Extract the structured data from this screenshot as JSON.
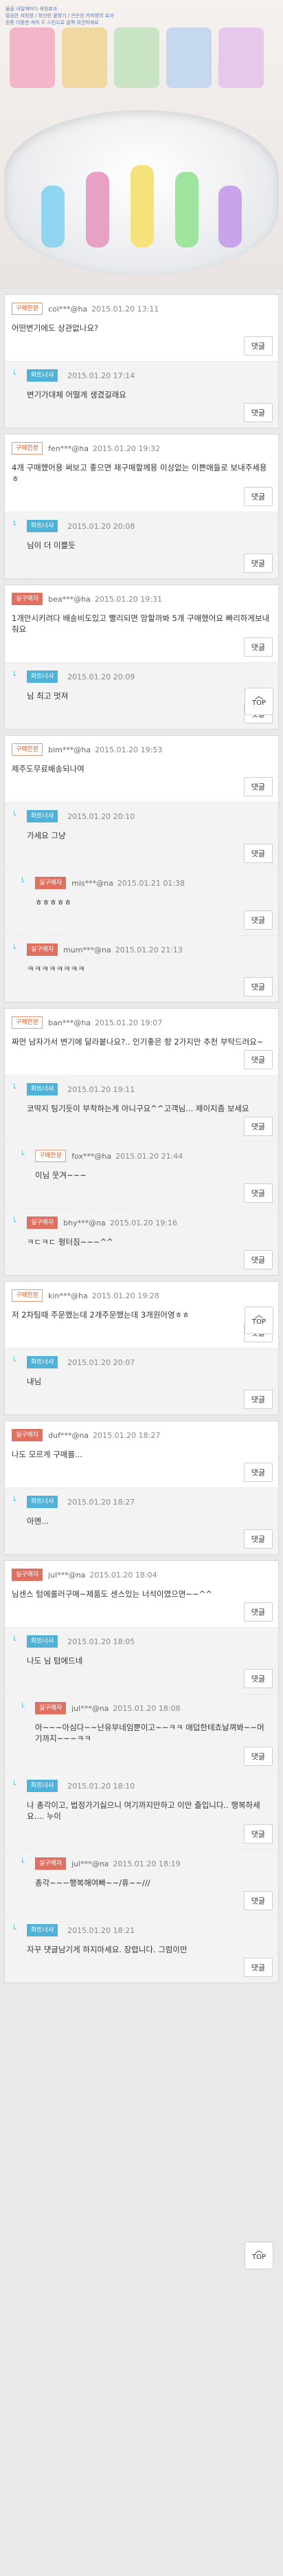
{
  "banner": {
    "bullets": [
      "물을 내릴때마다 세정효과",
      "말끔한 세정향 / 청산한 물향기 / 은은한 카피향의 효과",
      "원통 이중한 캐릭 두 스틴으로 컬팩 외관하세요"
    ]
  },
  "reply_label": "댓글",
  "top_label": "TOP",
  "tags": {
    "buyer": "구매한분",
    "seller": "화트너샤",
    "real": "실구매자"
  },
  "threads": [
    {
      "posts": [
        {
          "tag": "구매한분",
          "id": "col***@ha",
          "date": "2015.01.20 13:11",
          "text": "어떤변기에도 상관없나요?"
        },
        {
          "tag": "화트너샤",
          "id": "",
          "date": "2015.01.20 17:14",
          "text": "변기가대체 어떨게 생겼길래요"
        }
      ]
    },
    {
      "posts": [
        {
          "tag": "구매한분",
          "id": "fen***@ha",
          "date": "2015.01.20 19:32",
          "text": "4개 구매했어용 써보고 좋으면 재구매할께용 이상없는 이쁜애들로 보내주세용 ㅎ"
        },
        {
          "tag": "화트너샤",
          "id": "",
          "date": "2015.01.20 20:08",
          "text": "님이 더 이쁠듯"
        }
      ]
    },
    {
      "posts": [
        {
          "tag": "실구매자",
          "id": "bea***@ha",
          "date": "2015.01.20 19:31",
          "text": "1개만시키려다 배송비도있고 빨리되면 망할까봐 5개 구매했어요 빠리하게보내줘요"
        },
        {
          "tag": "화트너샤",
          "id": "",
          "date": "2015.01.20 20:09",
          "text": "님 최고 멋져"
        }
      ]
    },
    {
      "posts": [
        {
          "tag": "구매한분",
          "id": "bim***@ha",
          "date": "2015.01.20 19:53",
          "text": "제주도무료배송되나여"
        },
        {
          "tag": "화트너샤",
          "id": "",
          "date": "2015.01.20 20:10",
          "text": "가세요 그냥"
        },
        {
          "tag": "실구매자",
          "id": "mis***@na",
          "date": "2015.01.21 01:38",
          "text": "ㅎㅎㅎㅎㅎ"
        },
        {
          "tag": "실구매자",
          "id": "mum***@na",
          "date": "2015.01.20 21:13",
          "text": "ㅋㅋㅋㅋㅋㅋㅋㅋ"
        }
      ]
    },
    {
      "posts": [
        {
          "tag": "구매한분",
          "id": "ban***@ha",
          "date": "2015.01.20 19:07",
          "text": "짜먼 남자가서 변기에 달라붙나요?.. 인기좋은 향 2가지만 추천 부탁드려요~"
        },
        {
          "tag": "화트너샤",
          "id": "",
          "date": "2015.01.20 19:11",
          "text": "코딱지 팅기듯이 부착하는게 아니구요^^고객님... 제이지좀 보세요"
        },
        {
          "tag": "구매한분",
          "id": "fox***@ha",
          "date": "2015.01.20 21:44",
          "text": "이님 웃겨~~~"
        },
        {
          "tag": "실구매자",
          "id": "bhy***@na",
          "date": "2015.01.20 19:16",
          "text": "ㅋㄷㅋㄷ 펑터짐~~~^^"
        }
      ]
    },
    {
      "posts": [
        {
          "tag": "구매한분",
          "id": "kin***@ha",
          "date": "2015.01.20 19:28",
          "text": "저 2차팀때 주문했는데 2개주문했는데 3개원어영ㅎㅎ"
        },
        {
          "tag": "화트너샤",
          "id": "",
          "date": "2015.01.20 20:07",
          "text": "내님"
        }
      ]
    },
    {
      "posts": [
        {
          "tag": "실구매자",
          "id": "duf***@na",
          "date": "2015.01.20 18:27",
          "text": "나도 모르게 구매를..."
        },
        {
          "tag": "화트너샤",
          "id": "",
          "date": "2015.01.20 18:27",
          "text": "아멘..."
        }
      ]
    },
    {
      "posts": [
        {
          "tag": "실구매자",
          "id": "jul***@na",
          "date": "2015.01.20 18:04",
          "text": "님센스 텀에롤러구매~제품도 센스있는 너석이였으면~~^^"
        },
        {
          "tag": "화트너샤",
          "id": "",
          "date": "2015.01.20 18:05",
          "text": "나도 님 텀에드네"
        },
        {
          "tag": "실구매자",
          "id": "jul***@na",
          "date": "2015.01.20 18:08",
          "text": "아~~~아심다~~난유부네임뿐이고~~ㅋㅋ 애덥한테쵸날껴봐~~머기까지~~~ㅋㅋ"
        },
        {
          "tag": "화트너샤",
          "id": "",
          "date": "2015.01.20 18:10",
          "text": "나 총각이고, 법정가기싫으니 여기까지만하고 이만 즐입니다.. 행복하세요.... 누이"
        },
        {
          "tag": "실구매자",
          "id": "jul***@na",
          "date": "2015.01.20 18:19",
          "text": "총각~~~행복해여빠~~/휴~~///"
        },
        {
          "tag": "화트너샤",
          "id": "",
          "date": "2015.01.20 18:21",
          "text": "자꾸 댓글남기게 하지마세요. 장렵니다. 그럼이만"
        }
      ]
    }
  ]
}
